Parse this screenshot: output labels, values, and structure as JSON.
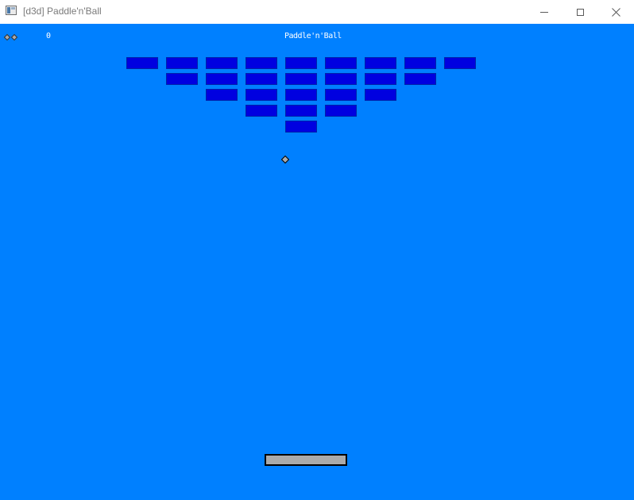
{
  "window": {
    "title": "[d3d] Paddle'n'Ball",
    "icon": "app-window-icon",
    "controls": [
      "minimize-icon",
      "maximize-icon",
      "close-icon"
    ]
  },
  "hud": {
    "lives": 2,
    "life_icon": "ball-life-icon",
    "score": "0",
    "game_title": "Paddle'n'Ball"
  },
  "colors": {
    "background": "#0080ff",
    "brick": "#0000e0",
    "brick_border": "#0022aa",
    "paddle": "#aaaaaa",
    "paddle_border": "#000000",
    "ball": "#aaaaaa",
    "text": "#ffffff"
  },
  "bricks": {
    "row_counts": [
      9,
      7,
      5,
      3,
      1
    ]
  }
}
